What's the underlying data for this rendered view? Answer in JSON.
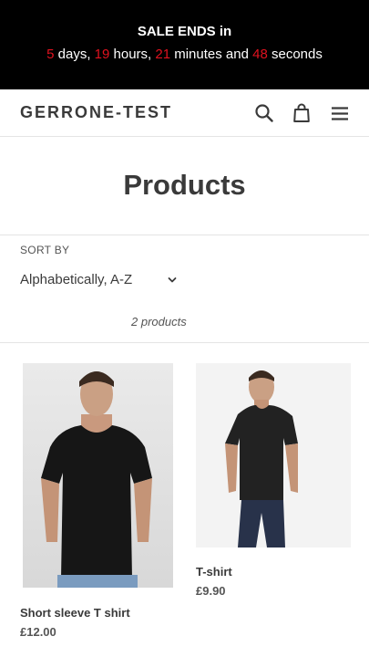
{
  "announcement": {
    "title": "SALE ENDS in",
    "days": "5",
    "days_label": " days, ",
    "hours": "19",
    "hours_label": " hours, ",
    "minutes": "21",
    "minutes_label": " minutes and ",
    "seconds": "48",
    "seconds_label": " seconds",
    "accent_color": "#e0121f"
  },
  "header": {
    "logo": "GERRONE-TEST",
    "icons": [
      "search-icon",
      "cart-icon",
      "menu-icon"
    ]
  },
  "collection": {
    "title": "Products",
    "sort_label": "SORT BY",
    "sort_value": "Alphabetically, A-Z",
    "product_count": "2 products"
  },
  "products": [
    {
      "title": "Short sleeve T shirt",
      "price": "£12.00"
    },
    {
      "title": "T-shirt",
      "price": "£9.90"
    }
  ]
}
